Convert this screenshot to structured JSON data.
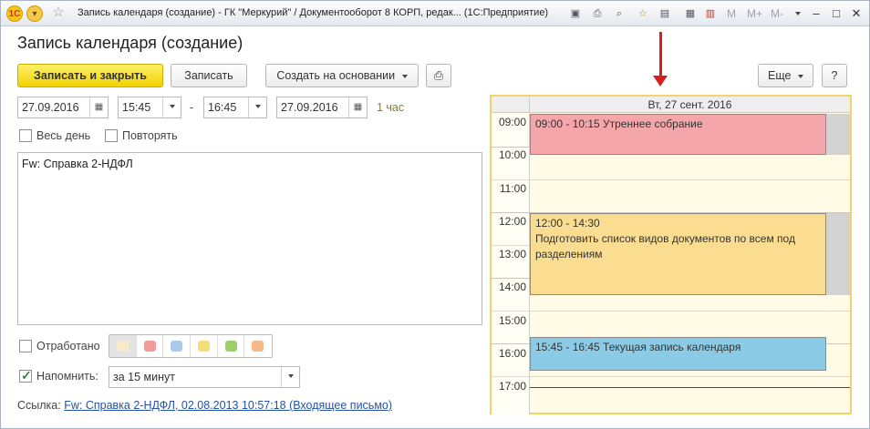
{
  "titlebar": {
    "title": "Запись календаря (создание) - ГК \"Меркурий\" / Документооборот 8 КОРП, редак... (1С:Предприятие)",
    "m_labels": [
      "M",
      "M+",
      "M-"
    ]
  },
  "form": {
    "title": "Запись календаря (создание)",
    "buttons": {
      "save_close": "Записать и закрыть",
      "save": "Записать",
      "create_based": "Создать на основании",
      "more": "Еще",
      "help": "?"
    },
    "date_start": "27.09.2016",
    "time_start": "15:45",
    "dash": "-",
    "time_end": "16:45",
    "date_end": "27.09.2016",
    "duration": "1 час",
    "all_day_label": "Весь день",
    "repeat_label": "Повторять",
    "subject": "Fw: Справка 2-НДФЛ",
    "done_label": "Отработано",
    "remind_label": "Напомнить:",
    "remind_value": "за 15 минут",
    "link_label": "Ссылка:",
    "link_text": "Fw: Справка 2-НДФЛ, 02.08.2013 10:57:18 (Входящее письмо)",
    "colors": [
      "#f8e9c9",
      "#f29a9a",
      "#a9c8ee",
      "#f7dc7a",
      "#9ccf6a",
      "#f7b98c"
    ]
  },
  "calendar": {
    "header": "Вт, 27 сент. 2016",
    "hours": [
      "09:00",
      "10:00",
      "11:00",
      "12:00",
      "13:00",
      "14:00",
      "15:00",
      "16:00",
      "17:00"
    ],
    "events": [
      {
        "text": "09:00 - 10:15 Утреннее собрание",
        "color": "#f4a6aa"
      },
      {
        "line1": "12:00 - 14:30",
        "line2": "Подготовить список видов документов по всем под разделениям",
        "color": "#fbdd91"
      },
      {
        "text": "15:45 - 16:45 Текущая запись календаря",
        "color": "#8ccbe6"
      }
    ]
  }
}
